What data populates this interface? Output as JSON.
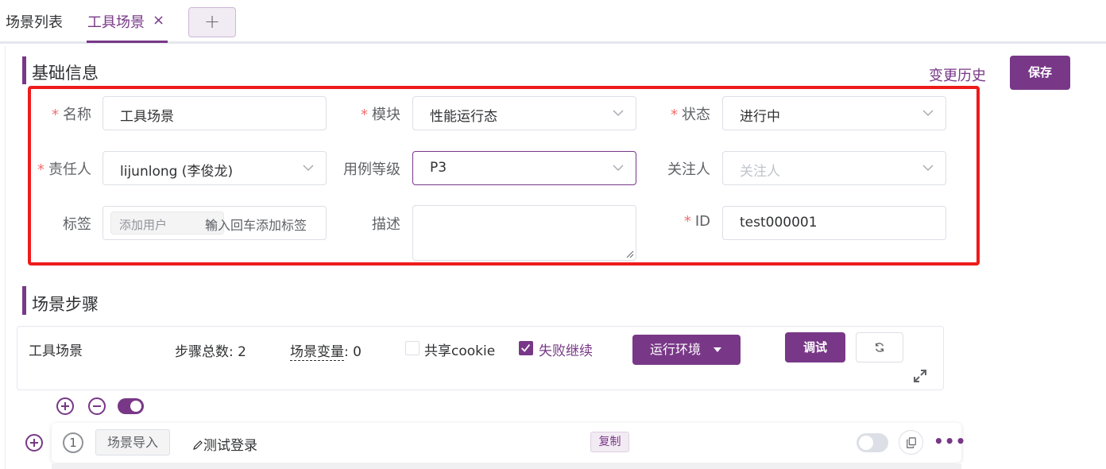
{
  "tabs": {
    "list_label": "场景列表",
    "active_label": "工具场景",
    "close_glyph": "×",
    "add_glyph": "+"
  },
  "basic_info": {
    "title": "基础信息",
    "history_link": "变更历史",
    "save_label": "保存",
    "fields": {
      "name": {
        "label": "名称",
        "required": "*",
        "value": "工具场景"
      },
      "module": {
        "label": "模块",
        "required": "*",
        "value": "性能运行态"
      },
      "status": {
        "label": "状态",
        "required": "*",
        "value": "进行中"
      },
      "owner": {
        "label": "责任人",
        "required": "*",
        "value": "lijunlong (李俊龙)"
      },
      "level": {
        "label": "用例等级",
        "value": "P3"
      },
      "follower": {
        "label": "关注人",
        "placeholder": "关注人"
      },
      "tags": {
        "label": "标签",
        "chip": "添加用户",
        "chip_close": "×",
        "placeholder": "输入回车添加标签"
      },
      "desc": {
        "label": "描述",
        "value": ""
      },
      "id": {
        "label": "ID",
        "required": "*",
        "value": "test000001"
      }
    }
  },
  "steps": {
    "title": "场景步骤",
    "scenario_name": "工具场景",
    "total_label": "步骤总数:",
    "total_value": "2",
    "var_label": "场景变量",
    "var_sep": ":",
    "var_value": "0",
    "share_cookie": {
      "label": "共享cookie",
      "checked": false
    },
    "fail_continue": {
      "label": "失败继续",
      "checked": true
    },
    "env_button": "运行环境",
    "debug_button": "调试",
    "step_list": [
      {
        "index": "1",
        "type": "场景导入",
        "name": "测试登录",
        "tag": "复制",
        "enabled": false
      }
    ]
  },
  "colors": {
    "accent": "#783887",
    "highlight_border": "#ee1b1b",
    "required": "#f56c6c"
  }
}
